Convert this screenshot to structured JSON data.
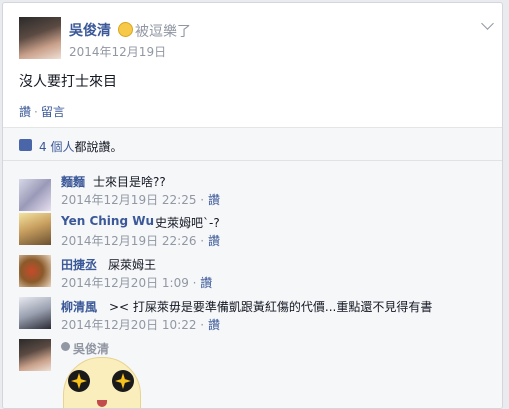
{
  "post": {
    "author": "吳俊清",
    "feeling": "被逗樂了",
    "timestamp": "2014年12月19日",
    "text": "沒人要打士來目",
    "actions": {
      "like": "讚",
      "comment": "留言",
      "separator": "·"
    }
  },
  "likes": {
    "count_text": "4 個人",
    "suffix": "都說讚。"
  },
  "comments": [
    {
      "name": "麵麵",
      "text": "士來目是啥??",
      "time": "2014年12月19日 22:25",
      "like": "讚"
    },
    {
      "name": "Yen Ching Wu",
      "text": "史萊姆吧`-?",
      "time": "2014年12月19日 22:26",
      "like": "讚"
    },
    {
      "name": "田捷丞",
      "text": "屎萊姆王",
      "time": "2014年12月20日 1:09",
      "like": "讚"
    },
    {
      "name": "柳清風",
      "text": ">< 打屎萊毋是要準備凱跟黃紅傷的代價...重點還不見得有書",
      "time": "2014年12月20日 10:22",
      "like": "讚"
    }
  ],
  "composer": {
    "name": "吳俊清"
  },
  "colors": {
    "link": "#3b5998",
    "muted": "#9197a3",
    "text": "#141823",
    "background": "#f6f7f9"
  },
  "icons": {
    "menu": "chevron-down-icon",
    "like": "thumbs-up-icon",
    "feeling": "smiley-emoji-icon",
    "sticker": "star-eyes-sticker"
  }
}
